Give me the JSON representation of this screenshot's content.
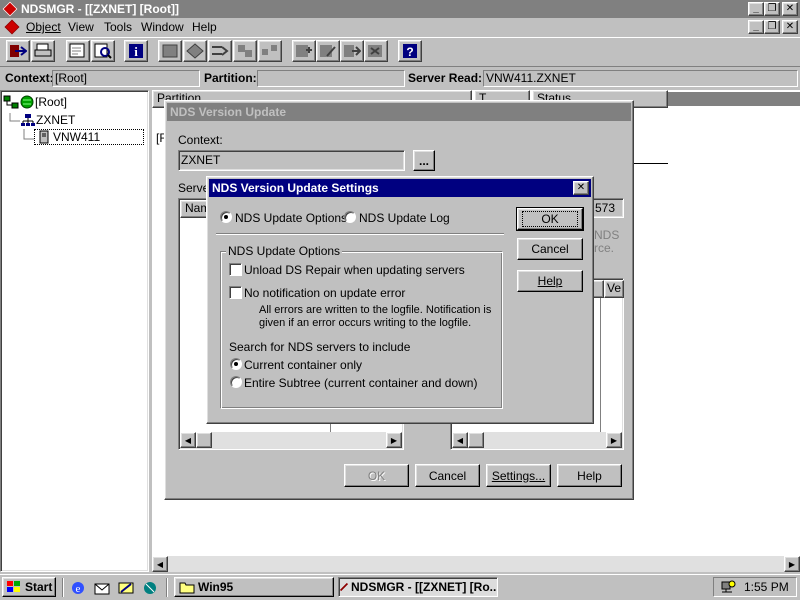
{
  "app": {
    "title": "NDSMGR - [[ZXNET] [Root]]",
    "menu": [
      "Object",
      "View",
      "Tools",
      "Window",
      "Help"
    ]
  },
  "infobar": {
    "context_label": "Context:",
    "context_value": "[Root]",
    "partition_label": "Partition:",
    "partition_value": "",
    "server_read_label": "Server Read:",
    "server_read_value": "VNW411.ZXNET"
  },
  "tree": {
    "root": "[Root]",
    "org": "ZXNET",
    "server": "VNW411"
  },
  "background_panel": {
    "header_partition": "Partition",
    "header_type": "T",
    "header_status": "Status",
    "row_partial": "[F"
  },
  "version_update": {
    "title": "NDS Version Update",
    "context_label": "Context:",
    "context_value": "ZXNET",
    "browse_label": "...",
    "servers_label": "Serve",
    "list_header": "Nam",
    "right_number": "573",
    "right_faded_1": "NDS",
    "right_faded_2": "rce.",
    "right_header": "Ve",
    "ok": "OK",
    "cancel": "Cancel",
    "settings": "Settings...",
    "help": "Help"
  },
  "settings_dialog": {
    "title": "NDS Version Update Settings",
    "radio_options": "NDS Update Options",
    "radio_log": "NDS Update Log",
    "group_title": "NDS Update Options",
    "check_unload": "Unload DS Repair when updating servers",
    "check_no_notification": "No notification on update error",
    "note_line1": "All errors are written to the logfile. Notification is",
    "note_line2": "given if an error occurs writing to the logfile.",
    "search_label": "Search for NDS servers to include",
    "radio_current": "Current container only",
    "radio_subtree": "Entire Subtree (current container and down)",
    "ok": "OK",
    "cancel": "Cancel",
    "help": "Help"
  },
  "taskbar": {
    "start": "Start",
    "task1": "Win95",
    "task2": "NDSMGR - [[ZXNET] [Ro...",
    "clock": "1:55 PM"
  },
  "colors": {
    "title_active": "#000080",
    "title_inactive": "#808080",
    "face": "#c0c0c0"
  }
}
